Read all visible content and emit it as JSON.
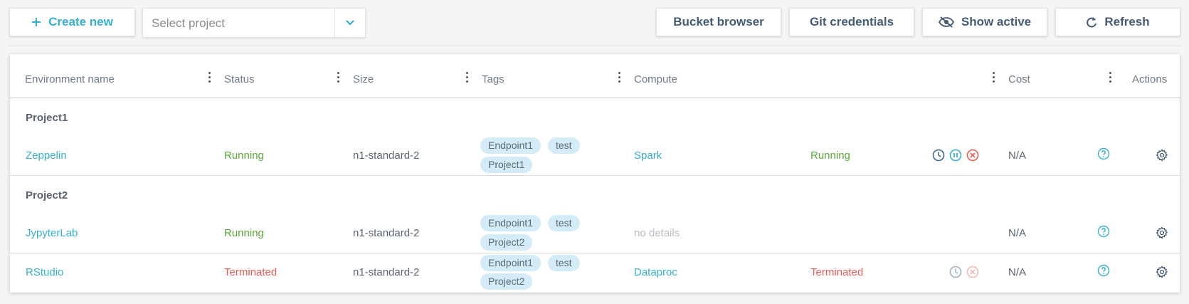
{
  "toolbar": {
    "create_label": "Create new",
    "project_placeholder": "Select project",
    "bucket_label": "Bucket browser",
    "git_label": "Git credentials",
    "show_active_label": "Show active",
    "refresh_label": "Refresh"
  },
  "table": {
    "headers": {
      "name": "Environment name",
      "status": "Status",
      "size": "Size",
      "tags": "Tags",
      "compute": "Compute",
      "cost": "Cost",
      "actions": "Actions"
    },
    "groups": [
      {
        "name": "Project1",
        "rows": [
          {
            "name": "Zeppelin",
            "status": "Running",
            "size": "n1-standard-2",
            "tags": [
              "Endpoint1",
              "test",
              "Project1"
            ],
            "compute": "Spark",
            "compute_status": "Running",
            "cost": "N/A"
          }
        ]
      },
      {
        "name": "Project2",
        "rows": [
          {
            "name": "JypyterLab",
            "status": "Running",
            "size": "n1-standard-2",
            "tags": [
              "Endpoint1",
              "test",
              "Project2"
            ],
            "compute": "no details",
            "compute_status": "",
            "cost": "N/A"
          },
          {
            "name": "RStudio",
            "status": "Terminated",
            "size": "n1-standard-2",
            "tags": [
              "Endpoint1",
              "test",
              "Project2"
            ],
            "compute": "Dataproc",
            "compute_status": "Terminated",
            "cost": "N/A"
          }
        ]
      }
    ]
  },
  "colors": {
    "accent": "#35afd5",
    "running": "#59a83a",
    "terminated": "#ef5a56"
  }
}
